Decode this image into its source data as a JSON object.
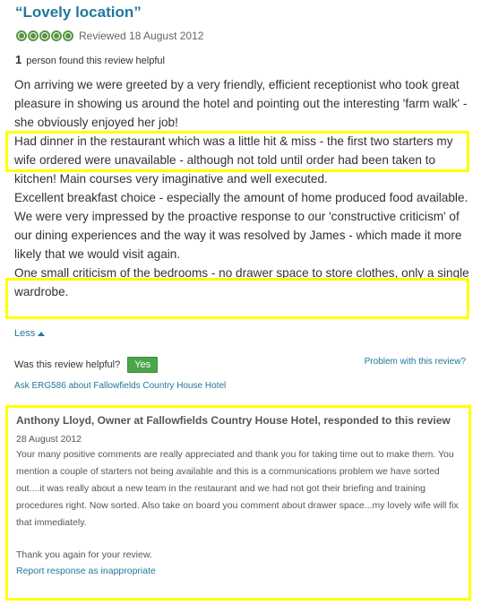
{
  "review": {
    "title": "“Lovely location”",
    "rating_bubbles": 5,
    "rating_color": "#589442",
    "reviewed_date": "Reviewed 18 August 2012",
    "helpful_count": "1",
    "helpful_text": "person found this review helpful",
    "paragraphs": [
      "On arriving we were greeted by a very friendly, efficient receptionist who took great pleasure in showing us around the hotel and pointing out the interesting 'farm walk' - she obviously enjoyed her job!",
      "Had dinner in the restaurant which was a little hit & miss - the first two starters my wife ordered were unavailable - although not told until order had been taken to kitchen! Main courses very imaginative and well executed.",
      "Excellent breakfast choice - especially the amount of home produced food available.",
      "We were very impressed by the proactive response to our 'constructive criticism' of our dining experiences and the way it was resolved by James - which made it more likely that we would visit again.",
      "One small criticism of the bedrooms - no drawer space to store clothes, only a single wardrobe."
    ],
    "less_label": "Less",
    "helpful_question": "Was this review helpful?",
    "yes_label": "Yes",
    "problem_link": "Problem with this review?",
    "ask_link": "Ask ERG586 about Fallowfields Country House Hotel"
  },
  "response": {
    "header": "Anthony Lloyd, Owner at Fallowfields Country House Hotel, responded to this review",
    "date": "28 August 2012",
    "body": "Your many positive comments are really appreciated and thank you for taking time out to make them. You mention a couple of starters not being available and this is a communications problem we have sorted out....it was really about a new team in the restaurant and we had not got their briefing and training procedures right. Now sorted. Also take on board you comment about drawer space...my lovely wife will fix that immediately.",
    "thanks": "Thank you again for your review.",
    "report_link": "Report response as inappropriate"
  },
  "colors": {
    "link": "#22789c",
    "highlight": "#ffff00",
    "yes_button": "#4aa64a"
  }
}
